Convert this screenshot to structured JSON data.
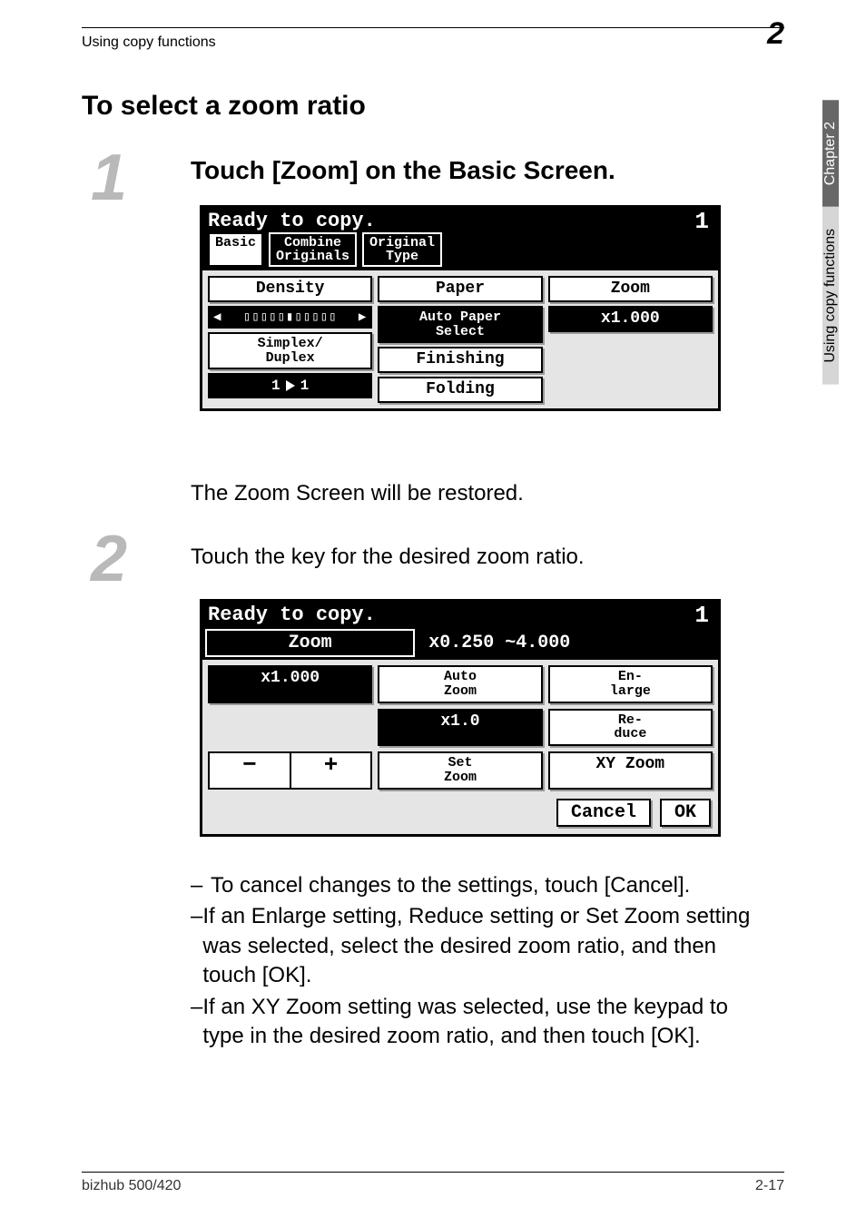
{
  "header": {
    "left": "Using copy functions",
    "badge": "2"
  },
  "sidebar": {
    "chapter": "Chapter 2",
    "label": "Using copy functions"
  },
  "section_title": "To select a zoom ratio",
  "steps": {
    "s1": {
      "num": "1",
      "text": "Touch [Zoom] on the Basic Screen."
    },
    "restored": "The Zoom Screen will be restored.",
    "s2": {
      "num": "2",
      "text": "Touch the key for the desired zoom ratio."
    }
  },
  "lcd1": {
    "ready": "Ready to copy.",
    "counter": "1",
    "tabs": {
      "basic": "Basic",
      "combine_l1": "Combine",
      "combine_l2": "Originals",
      "orig_l1": "Original",
      "orig_l2": "Type"
    },
    "col1": {
      "density": "Density",
      "simplex_l1": "Simplex/",
      "simplex_l2": "Duplex",
      "one_to_one_l": "1",
      "one_to_one_r": "1"
    },
    "col2": {
      "paper": "Paper",
      "autopaper_l1": "Auto Paper",
      "autopaper_l2": "Select",
      "finishing": "Finishing",
      "folding": "Folding"
    },
    "col3": {
      "zoom": "Zoom",
      "ratio": "x1.000"
    }
  },
  "lcd2": {
    "ready": "Ready to copy.",
    "counter": "1",
    "title": "Zoom",
    "range": "x0.250 ~4.000",
    "row1": {
      "a": "x1.000",
      "b_l1": "Auto",
      "b_l2": "Zoom",
      "c_l1": "En-",
      "c_l2": "large"
    },
    "row2": {
      "b": "x1.0",
      "c_l1": "Re-",
      "c_l2": "duce"
    },
    "row3": {
      "minus": "−",
      "plus": "+",
      "b_l1": "Set",
      "b_l2": "Zoom",
      "c": "XY Zoom"
    },
    "cancel": "Cancel",
    "ok": "OK"
  },
  "bullets": {
    "b1": "To cancel changes to the settings, touch [Cancel].",
    "b2": "If an Enlarge setting, Reduce setting or Set Zoom setting was selected, select the desired zoom ratio, and then touch [OK].",
    "b3": "If an XY Zoom setting was selected, use the keypad to type in the desired zoom ratio, and then touch [OK]."
  },
  "footer": {
    "left": "bizhub 500/420",
    "right": "2-17"
  }
}
